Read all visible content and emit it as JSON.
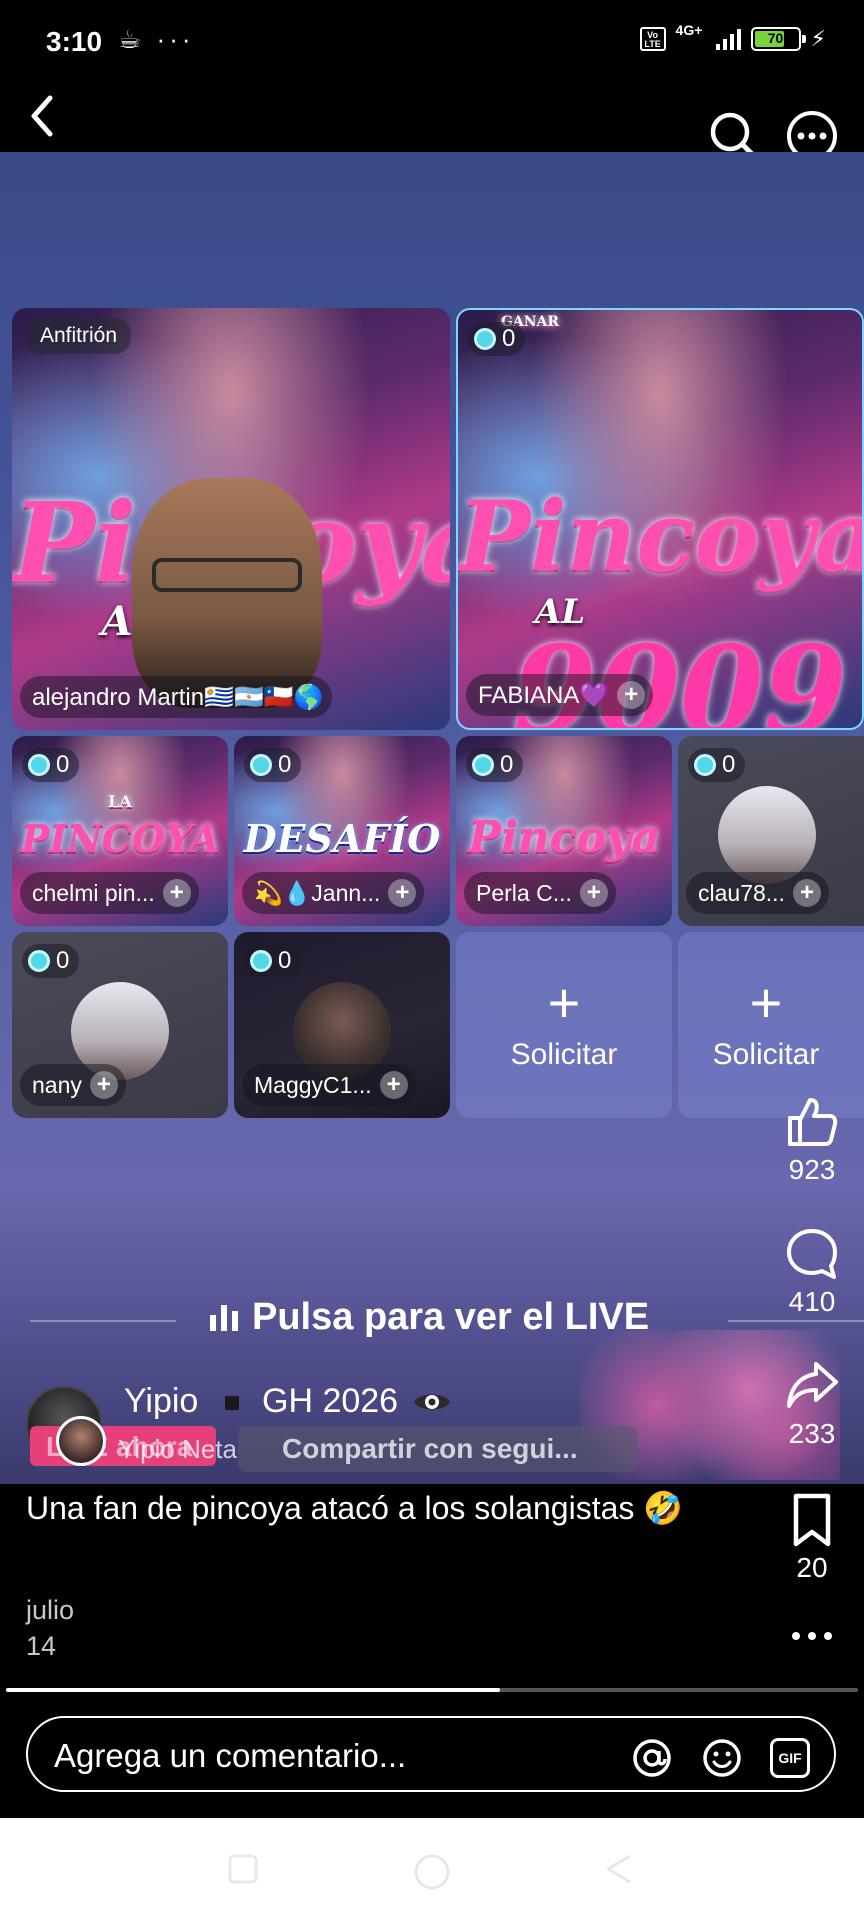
{
  "status_bar": {
    "time": "3:10",
    "left_icons": "☕ ···",
    "volte": "Vo LTE",
    "network": "4G+",
    "battery": "70",
    "battery_level": 0.7
  },
  "top_nav": {
    "back_icon": "chevron-left-icon",
    "search_icon": "search-icon",
    "more_icon": "more-horizontal-icon"
  },
  "live_grid": {
    "host_label": "Anfitrión",
    "host_name": "alejandro Martin🇺🇾🇦🇷🇨🇱🌎",
    "host_poster_title": "Pincoya",
    "host_poster_sub": "AL",
    "guest1": {
      "count": "0",
      "name": "FABIANA💜",
      "poster_title": "Pincoya",
      "poster_sub": "AL",
      "poster_num": "9009",
      "poster_top": "GANAR"
    },
    "small_tiles": [
      {
        "count": "0",
        "name": "chelmi pin...",
        "poster_text": "PINCOYA",
        "poster_top": "LA"
      },
      {
        "count": "0",
        "name": "💫💧Jann...",
        "poster_text": "DESAFÍO",
        "poster_top": ""
      },
      {
        "count": "0",
        "name": "Perla C...",
        "poster_text": "Pincoya",
        "poster_top": ""
      },
      {
        "count": "0",
        "name": "clau78...",
        "poster_text": "",
        "poster_top": ""
      }
    ],
    "row3": [
      {
        "count": "0",
        "name": "nany"
      },
      {
        "count": "0",
        "name": "MaggyC1..."
      }
    ],
    "request_label": "Solicitar",
    "request_icon": "plus-icon"
  },
  "rail": {
    "likes": "923",
    "comments": "410",
    "shares": "233",
    "saves": "20"
  },
  "live_banner": {
    "text": "Pulsa para ver el LIVE"
  },
  "creator": {
    "name": "Yipio",
    "tag": "GH 2026",
    "live_pill": "LIVE ahora",
    "co_host": "Yipio Neta",
    "share_pill": "Compartir con segui..."
  },
  "caption": {
    "text": "Una fan de pincoya atacó a los solangistas 🤣",
    "date_month": "julio",
    "date_day": "14"
  },
  "progress": {
    "fraction": 0.58
  },
  "comment": {
    "placeholder": "Agrega un comentario...",
    "mention_icon": "at-icon",
    "emoji_icon": "smiley-icon",
    "gif_label": "GIF"
  },
  "colors": {
    "accent_live": "#e5407a",
    "diamond": "#52d7e8",
    "battery": "#7ad33a"
  }
}
